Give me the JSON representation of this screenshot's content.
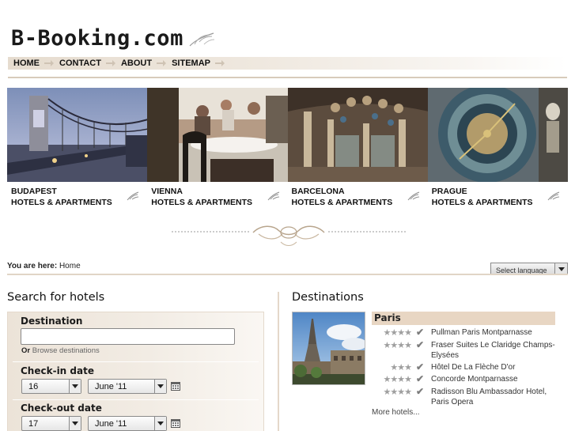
{
  "site": {
    "logo_text": "B-Booking.com"
  },
  "nav": {
    "items": [
      "HOME",
      "CONTACT",
      "ABOUT",
      "SITEMAP"
    ]
  },
  "cities": [
    {
      "name": "BUDAPEST",
      "subtitle": "HOTELS & APARTMENTS"
    },
    {
      "name": "VIENNA",
      "subtitle": "HOTELS & APARTMENTS"
    },
    {
      "name": "BARCELONA",
      "subtitle": "HOTELS & APARTMENTS"
    },
    {
      "name": "PRAGUE",
      "subtitle": "HOTELS & APARTMENTS"
    }
  ],
  "breadcrumb": {
    "prefix": "You are here:",
    "current": "Home"
  },
  "language_select": {
    "value": "Select language"
  },
  "search": {
    "title": "Search for hotels",
    "destination_label": "Destination",
    "destination_value": "",
    "browse_prefix": "Or",
    "browse_link": "Browse destinations",
    "checkin_label": "Check-in date",
    "checkin_day": "16",
    "checkin_month": "June '11",
    "checkout_label": "Check-out date",
    "checkout_day": "17",
    "checkout_month": "June '11"
  },
  "destinations": {
    "title": "Destinations",
    "city": "Paris",
    "hotels": [
      {
        "stars": 4,
        "name": "Pullman Paris Montparnasse"
      },
      {
        "stars": 4,
        "name": "Fraser Suites Le Claridge Champs-Elysées"
      },
      {
        "stars": 3,
        "name": "Hôtel De La Flèche D'or"
      },
      {
        "stars": 4,
        "name": "Concorde Montparnasse"
      },
      {
        "stars": 4,
        "name": "Radisson Blu Ambassador Hotel, Paris Opera"
      }
    ],
    "more_link": "More hotels..."
  },
  "colors": {
    "nav_gradient": "#e6dccf",
    "accent_bar": "#e8d6c3",
    "search_panel": "#ece3d8"
  }
}
